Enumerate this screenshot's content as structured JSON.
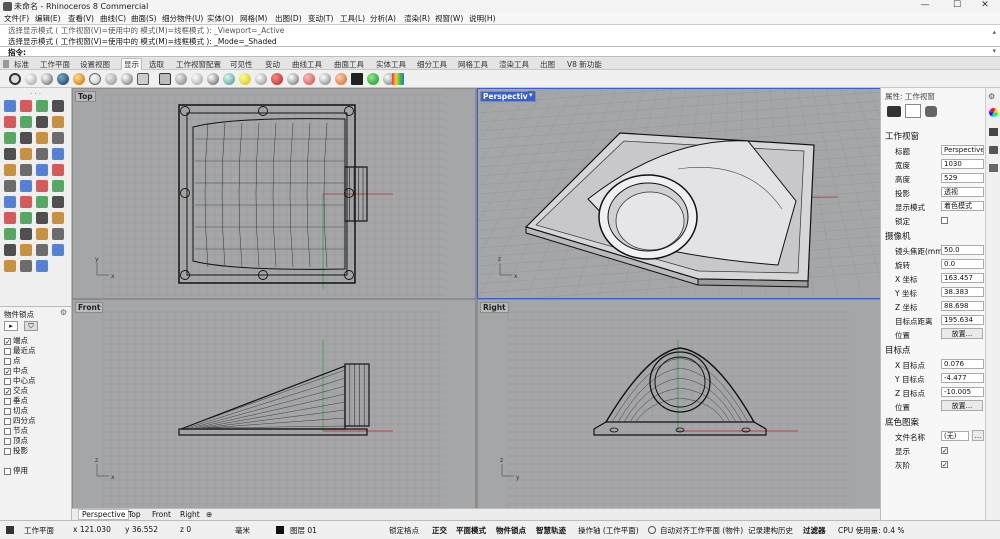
{
  "window": {
    "title": "未命名 - Rhinoceros 8 Commercial",
    "min": "—",
    "max": "☐",
    "close": "✕"
  },
  "menu": [
    "文件(F)",
    "编辑(E)",
    "查看(V)",
    "曲线(C)",
    "曲面(S)",
    "细分物件(U)",
    "实体(O)",
    "网格(M)",
    "出图(D)",
    "变动(T)",
    "工具(L)",
    "分析(A)",
    "渲染(R)",
    "视窗(W)",
    "说明(H)"
  ],
  "command_history": [
    "选择显示模式 ( 工作视窗(V)=使用中的  模式(M)=线框模式 ): _Viewport=_Active",
    "选择显示模式 ( 工作视窗(V)=使用中的  模式(M)=线框模式 ): _Mode=_Shaded"
  ],
  "command_prompt": "指令:",
  "toolbar_tabs": [
    {
      "label": "标准"
    },
    {
      "label": "工作平面"
    },
    {
      "label": "设置视图"
    },
    {
      "label": "显示",
      "active": true
    },
    {
      "label": "选取"
    },
    {
      "label": "工作视窗配置"
    },
    {
      "label": "可见性"
    },
    {
      "label": "变动"
    },
    {
      "label": "曲线工具"
    },
    {
      "label": "曲面工具"
    },
    {
      "label": "实体工具"
    },
    {
      "label": "细分工具"
    },
    {
      "label": "网格工具"
    },
    {
      "label": "渲染工具"
    },
    {
      "label": "出图"
    },
    {
      "label": "V8 新功能"
    }
  ],
  "osnap": {
    "title": "物件锁点",
    "items": [
      {
        "label": "端点",
        "checked": true
      },
      {
        "label": "最近点",
        "checked": false
      },
      {
        "label": "点",
        "checked": false
      },
      {
        "label": "中点",
        "checked": true
      },
      {
        "label": "中心点",
        "checked": false
      },
      {
        "label": "交点",
        "checked": true
      },
      {
        "label": "垂点",
        "checked": false
      },
      {
        "label": "切点",
        "checked": false
      },
      {
        "label": "四分点",
        "checked": false
      },
      {
        "label": "节点",
        "checked": false
      },
      {
        "label": "顶点",
        "checked": false
      },
      {
        "label": "投影",
        "checked": false
      }
    ],
    "disable": "停用"
  },
  "viewports": {
    "top": "Top",
    "perspective": "Perspective",
    "front": "Front",
    "right": "Right"
  },
  "viewport_tabs": [
    "Perspective",
    "Top",
    "Front",
    "Right",
    "⊕"
  ],
  "properties": {
    "header": "属性: 工作视窗",
    "section_viewport": "工作视窗",
    "title_label": "标题",
    "title_value": "Perspective",
    "width_label": "宽度",
    "width_value": "1030",
    "height_label": "高度",
    "height_value": "529",
    "projection_label": "投影",
    "projection_value": "透视",
    "display_label": "显示模式",
    "display_value": "着色模式",
    "lock_label": "锁定",
    "section_camera": "摄像机",
    "lens_label": "镜头焦距(mm",
    "lens_value": "50.0",
    "rotation_label": "旋转",
    "rotation_value": "0.0",
    "x_label": "X 坐标",
    "x_value": "163.457",
    "y_label": "Y 坐标",
    "y_value": "38.383",
    "z_label": "Z 坐标",
    "z_value": "88.698",
    "dist_label": "目标点距离",
    "dist_value": "195.634",
    "position_label": "位置",
    "place_button": "放置...",
    "section_target": "目标点",
    "tx_label": "X 目标点",
    "tx_value": "0.076",
    "ty_label": "Y 目标点",
    "ty_value": "-4.477",
    "tz_label": "Z 目标点",
    "tz_value": "-10.005",
    "tposition_label": "位置",
    "tplace_button": "放置...",
    "section_wallpaper": "底色图案",
    "filename_label": "文件名称",
    "filename_value": "(无)",
    "browse": "...",
    "show_label": "显示",
    "gray_label": "灰阶"
  },
  "status": {
    "cplane": "工作平面",
    "x": "x 121.030",
    "y": "y 36.552",
    "z": "z 0",
    "unit": "毫米",
    "layer": "图层 01",
    "items": [
      {
        "label": "锁定格点",
        "bold": false
      },
      {
        "label": "正交",
        "bold": true
      },
      {
        "label": "平面模式",
        "bold": true
      },
      {
        "label": "物件锁点",
        "bold": true
      },
      {
        "label": "智慧轨迹",
        "bold": true
      },
      {
        "label": "操作轴 (工作平面)",
        "bold": false
      },
      {
        "label": "自动对齐工作平面 (物件)",
        "bold": false
      },
      {
        "label": "记录建构历史",
        "bold": false
      },
      {
        "label": "过滤器",
        "bold": true
      },
      {
        "label": "CPU 使用量: 0.4 %",
        "bold": false
      }
    ]
  },
  "colors": {
    "accent": "#3a5fcc",
    "viewport_bg": "#a5a6a8",
    "grid": "#979899",
    "model_edge": "#111111",
    "axis_red": "#b03030",
    "axis_green": "#2f9a4a"
  }
}
